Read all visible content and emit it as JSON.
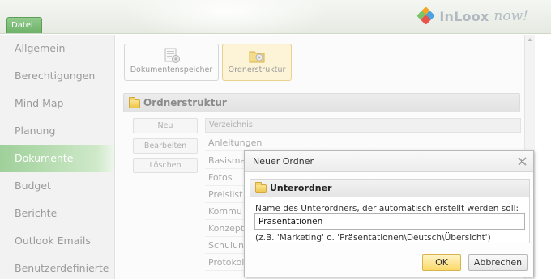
{
  "app": {
    "file_tab": "Datei",
    "logo": {
      "brand": "InLoox",
      "suffix": "now!"
    }
  },
  "sidebar": {
    "items": [
      {
        "label": "Allgemein",
        "active": false
      },
      {
        "label": "Berechtigungen",
        "active": false
      },
      {
        "label": "Mind Map",
        "active": false
      },
      {
        "label": "Planung",
        "active": false
      },
      {
        "label": "Dokumente",
        "active": true
      },
      {
        "label": "Budget",
        "active": false
      },
      {
        "label": "Berichte",
        "active": false
      },
      {
        "label": "Outlook Emails",
        "active": false
      },
      {
        "label": "Benutzerdefinierte",
        "active": false
      }
    ]
  },
  "toolbar": {
    "documents_storage": "Dokumentenspeicher",
    "folder_structure": "Ordnerstruktur"
  },
  "section": {
    "title": "Ordnerstruktur",
    "buttons": {
      "new": "Neu",
      "edit": "Bearbeiten",
      "delete": "Löschen"
    },
    "column_header": "Verzeichnis",
    "rows": [
      "Anleitungen",
      "Basisma",
      "Fotos",
      "Preislist",
      "Kommu",
      "Konzept",
      "Schulun",
      "Protokol"
    ]
  },
  "dialog": {
    "title": "Neuer Ordner",
    "group_title": "Unterordner",
    "label": "Name des Unterordners, der automatisch erstellt werden soll:",
    "value": "Präsentationen",
    "hint": "(z.B. 'Marketing' o. 'Präsentationen\\Deutsch\\Übersicht')",
    "ok": "OK",
    "cancel": "Abbrechen"
  },
  "colors": {
    "accent_green": "#6cb066",
    "active_gradient": "#9fd09a",
    "ok_yellow": "#fbd96a"
  }
}
